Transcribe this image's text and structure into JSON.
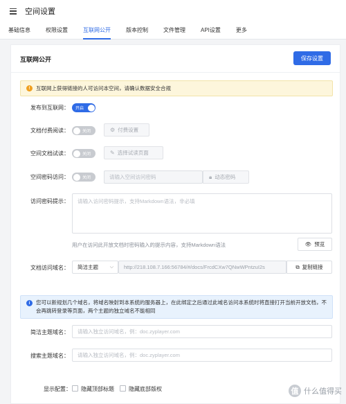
{
  "header": {
    "title": "空间设置"
  },
  "tabs": [
    {
      "label": "基础信息"
    },
    {
      "label": "权限设置"
    },
    {
      "label": "互联网公开"
    },
    {
      "label": "版本控制"
    },
    {
      "label": "文件管理"
    },
    {
      "label": "API设置"
    },
    {
      "label": "更多"
    }
  ],
  "active_tab": "互联网公开",
  "card": {
    "title": "互联网公开",
    "save_label": "保存设置",
    "warning": "互联网上获得链接的人可访问本空间，请确认数据安全合规",
    "publish": {
      "label": "发布到互联网：",
      "state": "开启"
    },
    "paid_read": {
      "label": "文档付费阅读：",
      "state": "关闭",
      "button": "付费设置"
    },
    "trial_read": {
      "label": "空间文档试读：",
      "state": "关闭",
      "button": "选择试读页面"
    },
    "password": {
      "label": "空间密码访问：",
      "state": "关闭",
      "placeholder": "请输入空间访问密码",
      "button": "动态密码"
    },
    "password_hint": {
      "label": "访问密码提示：",
      "placeholder": "请输入访问密码提示，支持Markdown语法，非必填",
      "help": "用户在访问此开放文档时密码输入的提示内容，支持Markdown语法",
      "preview_label": "预览"
    },
    "domain": {
      "label": "文档访问域名：",
      "theme": "简洁主题",
      "url": "http://218.108.7.166:56784/#/docs/FrcdCXw7QNwWPntzuI2s",
      "copy_label": "复制链接"
    },
    "info": "您可以新规划几个域名，将域名映射到本系统的服务器上，在此绑定之后通过此域名访问本系统时将直接打开当前开放文档，不会再跳转登录等页面，两个主题的独立域名不能相同",
    "simple_domain": {
      "label": "简洁主题域名：",
      "placeholder": "请输入独立访问域名，例：doc.zyplayer.com"
    },
    "search_domain": {
      "label": "搜索主题域名：",
      "placeholder": "请输入独立访问域名，例：doc.zyplayer.com"
    },
    "display": {
      "label": "显示配置：",
      "options": [
        "隐藏顶部标题",
        "隐藏底部版权"
      ]
    }
  },
  "watermark": {
    "text": "什么值得买",
    "logo": "值"
  },
  "colors": {
    "primary": "#2f6be6",
    "warning_bg": "#fdf6dc",
    "info_bg": "#e8f2fd"
  }
}
